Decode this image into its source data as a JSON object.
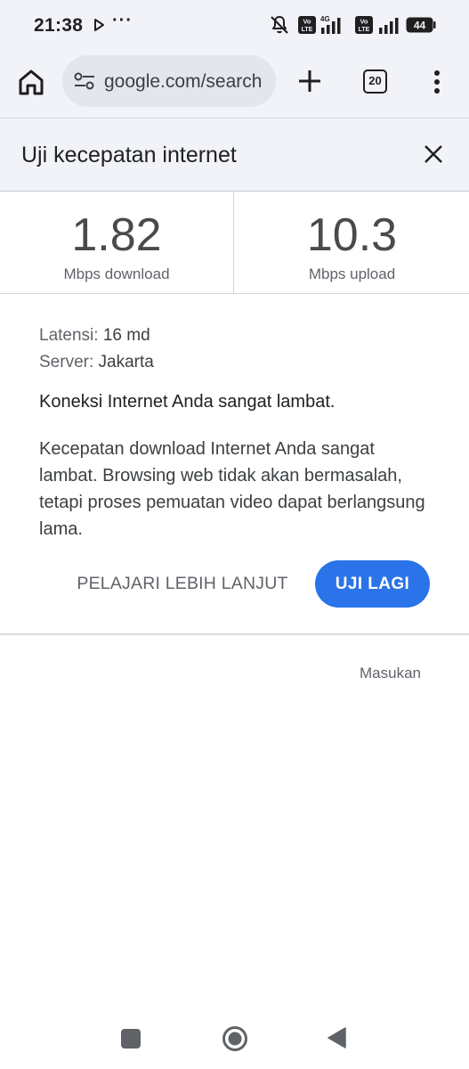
{
  "status_bar": {
    "time": "21:38",
    "more_indicator": "···",
    "network_type": "4G",
    "volte_label": "Vo LTE",
    "battery_level": "44"
  },
  "browser": {
    "url": "google.com/search",
    "tab_count": "20",
    "icons": [
      "home-icon",
      "tune-icon",
      "plus-icon",
      "tabs-icon",
      "more-vert-icon"
    ]
  },
  "speed_test": {
    "title": "Uji kecepatan internet",
    "download": {
      "value": "1.82",
      "unit": "Mbps download"
    },
    "upload": {
      "value": "10.3",
      "unit": "Mbps upload"
    },
    "latency": {
      "label": "Latensi:",
      "value": "16 md"
    },
    "server": {
      "label": "Server:",
      "value": "Jakarta"
    },
    "verdict": "Koneksi Internet Anda sangat lambat.",
    "description": "Kecepatan download Internet Anda sangat lambat. Browsing web tidak akan bermasalah, tetapi proses pemuatan video dapat berlangsung lama.",
    "learn_more_label": "PELAJARI LEBIH LANJUT",
    "retry_label": "UJI LAGI",
    "feedback_label": "Masukan",
    "accent_color": "#2a73e8"
  }
}
